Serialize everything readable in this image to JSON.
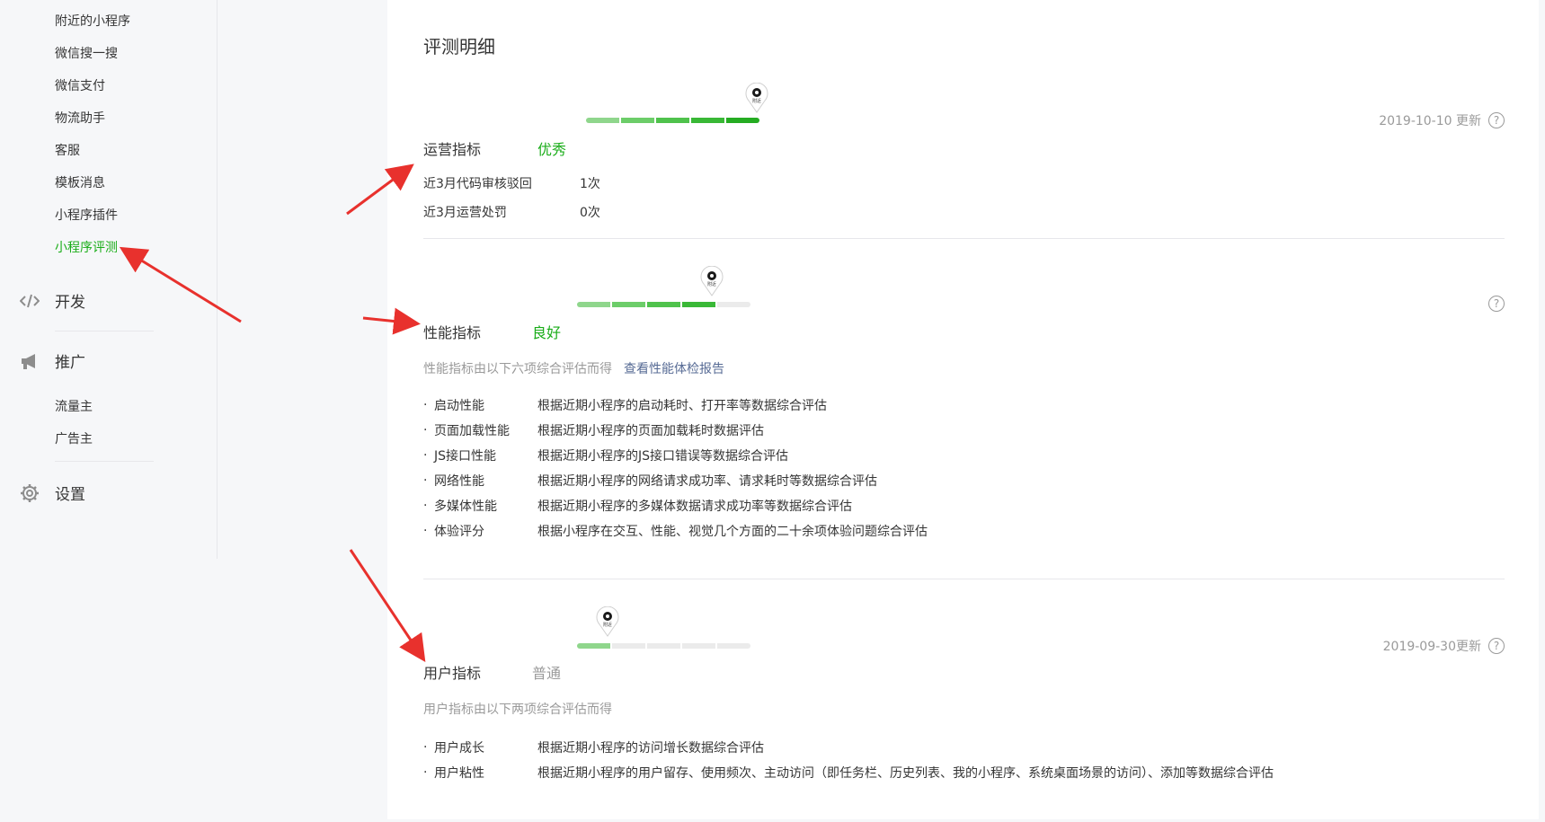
{
  "sidebar": {
    "items": [
      {
        "label": "附近的小程序"
      },
      {
        "label": "微信搜一搜"
      },
      {
        "label": "微信支付"
      },
      {
        "label": "物流助手"
      },
      {
        "label": "客服"
      },
      {
        "label": "模板消息"
      },
      {
        "label": "小程序插件"
      },
      {
        "label": "小程序评测",
        "active": true
      }
    ],
    "groups": [
      {
        "label": "开发",
        "icon": "code-icon"
      },
      {
        "label": "推广",
        "icon": "megaphone-icon",
        "items": [
          {
            "label": "流量主"
          },
          {
            "label": "广告主"
          }
        ]
      },
      {
        "label": "设置",
        "icon": "gear-icon"
      }
    ]
  },
  "main": {
    "title": "评测明细",
    "pin_label": "附近",
    "operations": {
      "title": "运营指标",
      "grade": "优秀",
      "grade_color": "#1aad19",
      "level": 5,
      "max_level": 5,
      "updated": "2019-10-10 更新",
      "rows": [
        {
          "label": "近3月代码审核驳回",
          "value": "1次"
        },
        {
          "label": "近3月运营处罚",
          "value": "0次"
        }
      ]
    },
    "performance": {
      "title": "性能指标",
      "grade": "良好",
      "grade_color": "#1aad19",
      "level": 4,
      "max_level": 5,
      "desc": "性能指标由以下六项综合评估而得",
      "report_link": "查看性能体检报告",
      "items": [
        {
          "name": "启动性能",
          "text": "根据近期小程序的启动耗时、打开率等数据综合评估"
        },
        {
          "name": "页面加载性能",
          "text": "根据近期小程序的页面加载耗时数据评估"
        },
        {
          "name": "JS接口性能",
          "text": "根据近期小程序的JS接口错误等数据综合评估"
        },
        {
          "name": "网络性能",
          "text": "根据近期小程序的网络请求成功率、请求耗时等数据综合评估"
        },
        {
          "name": "多媒体性能",
          "text": "根据近期小程序的多媒体数据请求成功率等数据综合评估"
        },
        {
          "name": "体验评分",
          "text": "根据小程序在交互、性能、视觉几个方面的二十余项体验问题综合评估"
        }
      ]
    },
    "users": {
      "title": "用户指标",
      "grade": "普通",
      "grade_color": "#9a9a9a",
      "level": 1,
      "max_level": 5,
      "updated": "2019-09-30更新",
      "desc": "用户指标由以下两项综合评估而得",
      "items": [
        {
          "name": "用户成长",
          "text": "根据近期小程序的访问增长数据综合评估"
        },
        {
          "name": "用户粘性",
          "text": "根据近期小程序的用户留存、使用频次、主动访问（即任务栏、历史列表、我的小程序、系统桌面场景的访问）、添加等数据综合评估"
        }
      ]
    },
    "help_symbol": "?"
  },
  "annotations": {
    "arrow_color": "#e8312d"
  }
}
